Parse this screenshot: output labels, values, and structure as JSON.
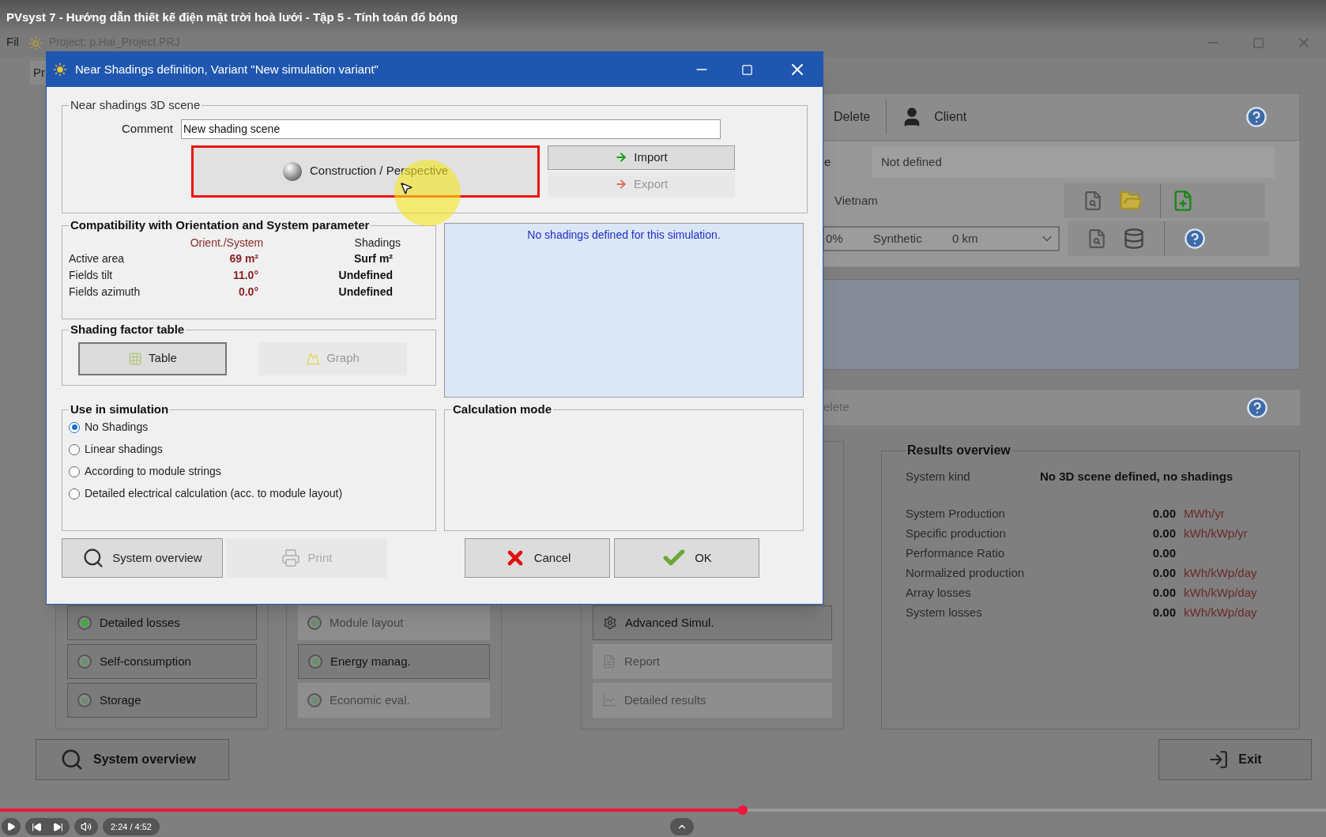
{
  "video": {
    "title": "PVsyst 7 - Hướng dẫn thiết kế điện mặt trời hoà lưới - Tập 5 - Tính toán đổ bóng",
    "time": "2:24 / 4:52",
    "progress": {
      "level": 0.56
    }
  },
  "app": {
    "menu": "Fil",
    "project": "Project: p.Hai_Project.PRJ",
    "tab": "Pr",
    "toolbar": [
      {
        "label": "Delete"
      },
      {
        "label": "Client"
      }
    ],
    "row_label": "e",
    "not_defined": "Not defined",
    "site": "Vietnam",
    "meteo": {
      "albedo": "0%",
      "kind": "Synthetic",
      "distance": "0 km"
    },
    "section_label": "elete",
    "groups": [
      {
        "items": [
          {
            "label": "Detailed losses",
            "disabled": false,
            "color": "#3fae3f"
          },
          {
            "label": "Self-consumption",
            "disabled": false,
            "color": "#6e8f6e"
          },
          {
            "label": "Storage",
            "disabled": false,
            "color": "#6e8f6e"
          }
        ]
      },
      {
        "items": [
          {
            "label": "Module layout",
            "disabled": true,
            "color": "#6e8f6e"
          },
          {
            "label": "Energy manag.",
            "disabled": false,
            "color": "#6e8f6e"
          },
          {
            "label": "Economic eval.",
            "disabled": true,
            "color": "#6e8f6e"
          }
        ]
      },
      {
        "items": [
          {
            "label": "Advanced Simul.",
            "disabled": false,
            "kind": "gear"
          },
          {
            "label": "Report",
            "disabled": true,
            "kind": "report"
          },
          {
            "label": "Detailed results",
            "disabled": true,
            "kind": "chart"
          }
        ]
      }
    ],
    "results": {
      "legend": "Results overview",
      "system_kind_label": "System kind",
      "system_kind": "No 3D scene defined, no shadings",
      "rows": [
        {
          "label": "System Production",
          "value": "0.00",
          "unit": "MWh/yr"
        },
        {
          "label": "Specific production",
          "value": "0.00",
          "unit": "kWh/kWp/yr"
        },
        {
          "label": "Performance Ratio",
          "value": "0.00"
        },
        {
          "label": "Normalized production",
          "value": "0.00",
          "unit": "kWh/kWp/day"
        },
        {
          "label": "Array losses",
          "value": "0.00",
          "unit": "kWh/kWp/day"
        },
        {
          "label": "System losses",
          "value": "0.00",
          "unit": "kWh/kWp/day"
        }
      ]
    },
    "system_overview": "System overview",
    "exit": "Exit"
  },
  "dialog": {
    "title": "Near Shadings definition, Variant \"New simulation variant\"",
    "scene": {
      "legend": "Near shadings 3D scene",
      "comment_label": "Comment",
      "comment": "New shading scene",
      "construction": {
        "label": "Construction / Perspective",
        "highlighted": true
      },
      "import": {
        "label": "Import",
        "disabled": false
      },
      "export": {
        "label": "Export",
        "disabled": true
      }
    },
    "compatibility": {
      "legend": "Compatibility with Orientation and System parameter",
      "columns": [
        "Orient./System",
        "Shadings"
      ],
      "rows": [
        {
          "label": "Active area",
          "orient": "69 m²",
          "shadings": "Surf m²"
        },
        {
          "label": "Fields tilt",
          "orient": "11.0°",
          "shadings": "Undefined"
        },
        {
          "label": "Fields azimuth",
          "orient": "0.0°",
          "shadings": "Undefined"
        }
      ]
    },
    "message": "No shadings defined for this simulation.",
    "shading_table": {
      "legend": "Shading factor table",
      "buttons": [
        {
          "label": "Table",
          "kind": "table",
          "disabled": false
        },
        {
          "label": "Graph",
          "kind": "graph",
          "disabled": true
        }
      ]
    },
    "use_in_simulation": {
      "legend": "Use in simulation",
      "options": [
        {
          "label": "No Shadings",
          "selected": true
        },
        {
          "label": "Linear shadings",
          "selected": false
        },
        {
          "label": "According to module strings",
          "selected": false
        },
        {
          "label": "Detailed electrical calculation (acc. to module layout)",
          "selected": false
        }
      ]
    },
    "calculation_mode": {
      "legend": "Calculation mode"
    },
    "buttons": [
      {
        "label": "System overview",
        "kind": "search",
        "disabled": false
      },
      {
        "label": "Print",
        "kind": "print",
        "disabled": true
      },
      {
        "label": "Cancel",
        "kind": "cancel",
        "disabled": false
      },
      {
        "label": "OK",
        "kind": "ok",
        "disabled": false
      }
    ]
  }
}
